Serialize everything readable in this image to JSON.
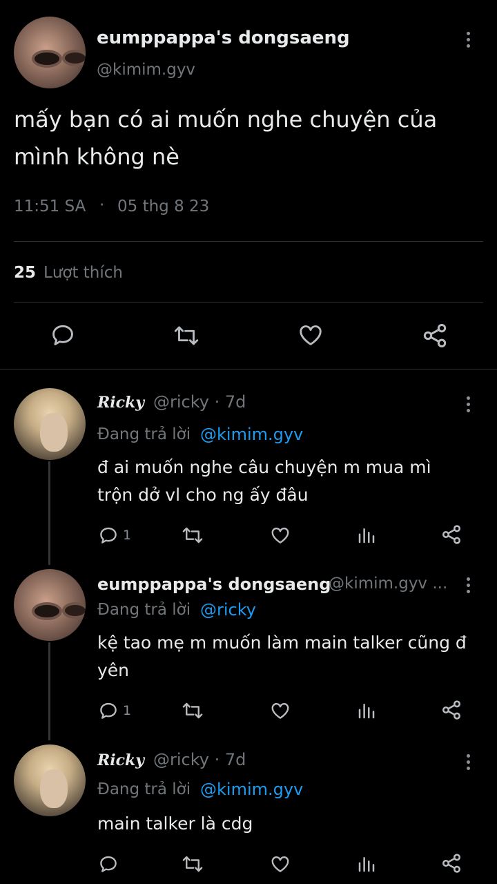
{
  "main_tweet": {
    "display_name": "eumppappa's dongsaeng",
    "handle": "@kimim.gyv",
    "text_line1": "mấy bạn có ai muốn nghe chuyện của",
    "text_line2": "mình không nè",
    "time": "11:51 SA",
    "separator": "·",
    "date": "05 thg 8 23",
    "likes_count": "25",
    "likes_label": "Lượt thích"
  },
  "replies": [
    {
      "display_name": "Ricky",
      "handle_time": "@ricky · 7d",
      "replying_prefix": "Đang trả lời",
      "replying_to": "@kimim.gyv",
      "text_line1": "đ ai muốn nghe câu chuyện m mua mì",
      "text_line2": "trộn dở vl cho ng ấy đâu",
      "reply_count": "1"
    },
    {
      "display_name": "eumppappa's dongsaeng",
      "handle_time": "@kimim.gyv ...",
      "replying_prefix": "Đang trả lời",
      "replying_to": "@ricky",
      "text_line1": "kệ tao mẹ m muốn làm main talker cũng đ",
      "text_line2": "yên",
      "reply_count": "1"
    },
    {
      "display_name": "Ricky",
      "handle_time": "@ricky · 7d",
      "replying_prefix": "Đang trả lời",
      "replying_to": "@kimim.gyv",
      "text_line1": "main talker là cdg",
      "text_line2": "",
      "reply_count": ""
    }
  ],
  "icons": [
    "more-vertical-icon",
    "reply-icon",
    "retweet-icon",
    "like-icon",
    "share-icon",
    "views-icon"
  ],
  "colors": {
    "background": "#000000",
    "text": "#e7e9ea",
    "muted": "#71767b",
    "link": "#1d9bf0",
    "divider": "#2f3336"
  }
}
